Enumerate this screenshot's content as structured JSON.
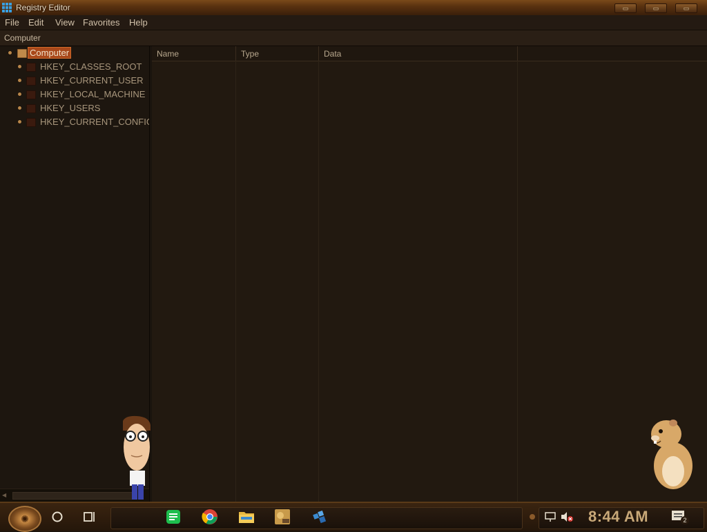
{
  "window": {
    "title": "Registry Editor",
    "minimize_label": "▭",
    "maximize_label": "▭",
    "close_label": "▭"
  },
  "menu": [
    "File",
    "Edit",
    "View",
    "Favorites",
    "Help"
  ],
  "address": {
    "path": "Computer"
  },
  "tree": {
    "root": "Computer",
    "keys": [
      "HKEY_CLASSES_ROOT",
      "HKEY_CURRENT_USER",
      "HKEY_LOCAL_MACHINE",
      "HKEY_USERS",
      "HKEY_CURRENT_CONFIG"
    ]
  },
  "list": {
    "columns": [
      "Name",
      "Type",
      "Data"
    ]
  },
  "taskbar": {
    "clock": "8:44 AM",
    "notification_count": "2",
    "apps": [
      "start-orb-icon",
      "search-circle-icon",
      "task-view-icon",
      "chat-app-icon",
      "chrome-icon",
      "file-explorer-icon",
      "game-app-icon",
      "registry-editor-icon"
    ]
  },
  "colors": {
    "selection": "#a8481a",
    "accent": "#c8a878"
  }
}
